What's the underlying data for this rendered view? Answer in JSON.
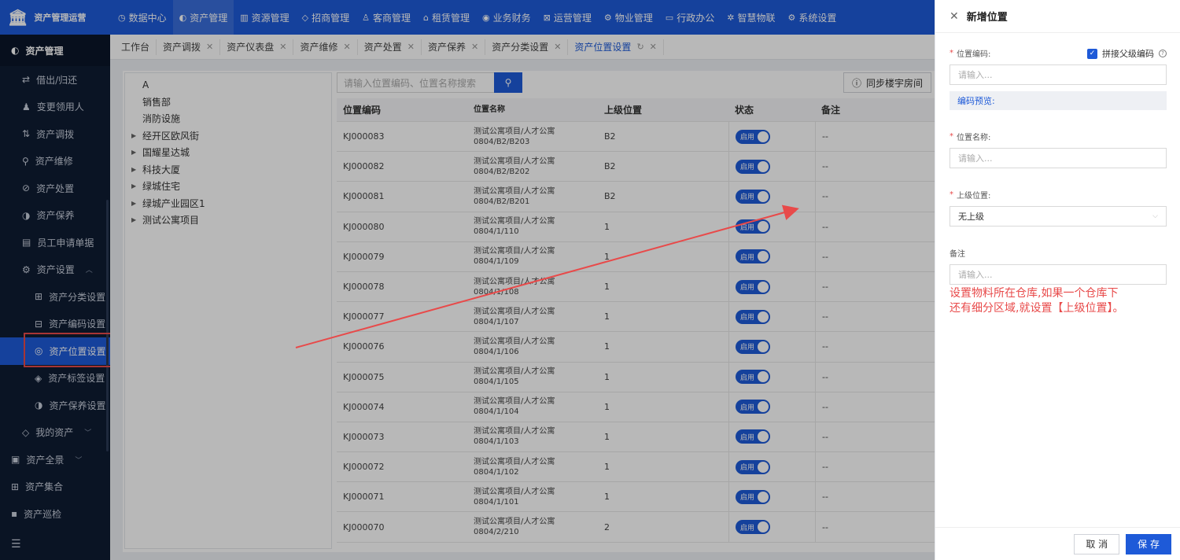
{
  "app": {
    "title": "资产管理运营"
  },
  "topnav": [
    {
      "label": "数据中心",
      "icon": "clock-icon"
    },
    {
      "label": "资产管理",
      "icon": "grid-icon"
    },
    {
      "label": "资源管理",
      "icon": "building-icon"
    },
    {
      "label": "招商管理",
      "icon": "tag-icon"
    },
    {
      "label": "客商管理",
      "icon": "users-icon"
    },
    {
      "label": "租赁管理",
      "icon": "home-icon"
    },
    {
      "label": "业务财务",
      "icon": "coin-icon"
    },
    {
      "label": "运营管理",
      "icon": "chart-icon"
    },
    {
      "label": "物业管理",
      "icon": "wrench-icon"
    },
    {
      "label": "行政办公",
      "icon": "monitor-icon"
    },
    {
      "label": "智慧物联",
      "icon": "star-icon"
    },
    {
      "label": "系统设置",
      "icon": "gear-icon"
    }
  ],
  "sidebar": {
    "header": "资产管理",
    "items": [
      {
        "label": "借出/归还",
        "icon": "swap-icon"
      },
      {
        "label": "变更领用人",
        "icon": "person-icon"
      },
      {
        "label": "资产调拨",
        "icon": "transfer-icon"
      },
      {
        "label": "资产维修",
        "icon": "search-icon"
      },
      {
        "label": "资产处置",
        "icon": "dispose-icon"
      },
      {
        "label": "资产保养",
        "icon": "care-icon"
      },
      {
        "label": "员工申请单据",
        "icon": "doc-icon"
      },
      {
        "label": "资产设置",
        "icon": "settings-icon"
      }
    ],
    "sub_items": [
      {
        "label": "资产分类设置",
        "icon": "category-icon"
      },
      {
        "label": "资产编码设置",
        "icon": "code-icon"
      },
      {
        "label": "资产位置设置",
        "icon": "location-icon"
      },
      {
        "label": "资产标签设置",
        "icon": "label-icon"
      },
      {
        "label": "资产保养设置",
        "icon": "care-icon"
      }
    ],
    "after_items": [
      {
        "label": "我的资产",
        "icon": "box-icon"
      }
    ],
    "top_items": [
      {
        "label": "资产全景",
        "icon": "panorama-icon"
      },
      {
        "label": "资产集合",
        "icon": "collection-icon"
      },
      {
        "label": "资产巡检",
        "icon": "inspect-icon"
      }
    ]
  },
  "tabs": [
    {
      "label": "工作台"
    },
    {
      "label": "资产调拨"
    },
    {
      "label": "资产仪表盘"
    },
    {
      "label": "资产维修"
    },
    {
      "label": "资产处置"
    },
    {
      "label": "资产保养"
    },
    {
      "label": "资产分类设置"
    },
    {
      "label": "资产位置设置"
    }
  ],
  "tree": [
    "A",
    "销售部",
    "消防设施",
    "经开区欧风街",
    "国耀星达城",
    "科技大厦",
    "绿城住宅",
    "绿城产业园区1",
    "测试公寓项目"
  ],
  "search": {
    "placeholder": "请输入位置编码、位置名称搜索"
  },
  "sync_button": "同步楼宇房间",
  "table": {
    "headers": [
      "位置编码",
      "位置名称",
      "上级位置",
      "状态",
      "备注"
    ],
    "rows": [
      {
        "code": "KJ000083",
        "name": "测试公寓项目/人才公寓0804/B2/B203",
        "parent": "B2",
        "status": "启用",
        "remark": "--"
      },
      {
        "code": "KJ000082",
        "name": "测试公寓项目/人才公寓0804/B2/B202",
        "parent": "B2",
        "status": "启用",
        "remark": "--"
      },
      {
        "code": "KJ000081",
        "name": "测试公寓项目/人才公寓0804/B2/B201",
        "parent": "B2",
        "status": "启用",
        "remark": "--"
      },
      {
        "code": "KJ000080",
        "name": "测试公寓项目/人才公寓0804/1/110",
        "parent": "1",
        "status": "启用",
        "remark": "--"
      },
      {
        "code": "KJ000079",
        "name": "测试公寓项目/人才公寓0804/1/109",
        "parent": "1",
        "status": "启用",
        "remark": "--"
      },
      {
        "code": "KJ000078",
        "name": "测试公寓项目/人才公寓0804/1/108",
        "parent": "1",
        "status": "启用",
        "remark": "--"
      },
      {
        "code": "KJ000077",
        "name": "测试公寓项目/人才公寓0804/1/107",
        "parent": "1",
        "status": "启用",
        "remark": "--"
      },
      {
        "code": "KJ000076",
        "name": "测试公寓项目/人才公寓0804/1/106",
        "parent": "1",
        "status": "启用",
        "remark": "--"
      },
      {
        "code": "KJ000075",
        "name": "测试公寓项目/人才公寓0804/1/105",
        "parent": "1",
        "status": "启用",
        "remark": "--"
      },
      {
        "code": "KJ000074",
        "name": "测试公寓项目/人才公寓0804/1/104",
        "parent": "1",
        "status": "启用",
        "remark": "--"
      },
      {
        "code": "KJ000073",
        "name": "测试公寓项目/人才公寓0804/1/103",
        "parent": "1",
        "status": "启用",
        "remark": "--"
      },
      {
        "code": "KJ000072",
        "name": "测试公寓项目/人才公寓0804/1/102",
        "parent": "1",
        "status": "启用",
        "remark": "--"
      },
      {
        "code": "KJ000071",
        "name": "测试公寓项目/人才公寓0804/1/101",
        "parent": "1",
        "status": "启用",
        "remark": "--"
      },
      {
        "code": "KJ000070",
        "name": "测试公寓项目/人才公寓0804/2/210",
        "parent": "2",
        "status": "启用",
        "remark": "--"
      }
    ]
  },
  "drawer": {
    "title": "新增位置",
    "code_label": "位置编码:",
    "concat_label": "拼接父级编码",
    "code_placeholder": "请输入...",
    "preview_label": "编码预览:",
    "name_label": "位置名称:",
    "name_placeholder": "请输入...",
    "parent_label": "上级位置:",
    "parent_value": "无上级",
    "remark_label": "备注",
    "remark_placeholder": "请输入...",
    "note_line1": "设置物料所在仓库,如果一个仓库下",
    "note_line2": "还有细分区域,就设置【上级位置】。",
    "cancel": "取 消",
    "save": "保 存"
  },
  "colors": {
    "primary": "#1e5ad8",
    "sidebar": "#0f1c33",
    "annotation": "#e84a4a"
  }
}
